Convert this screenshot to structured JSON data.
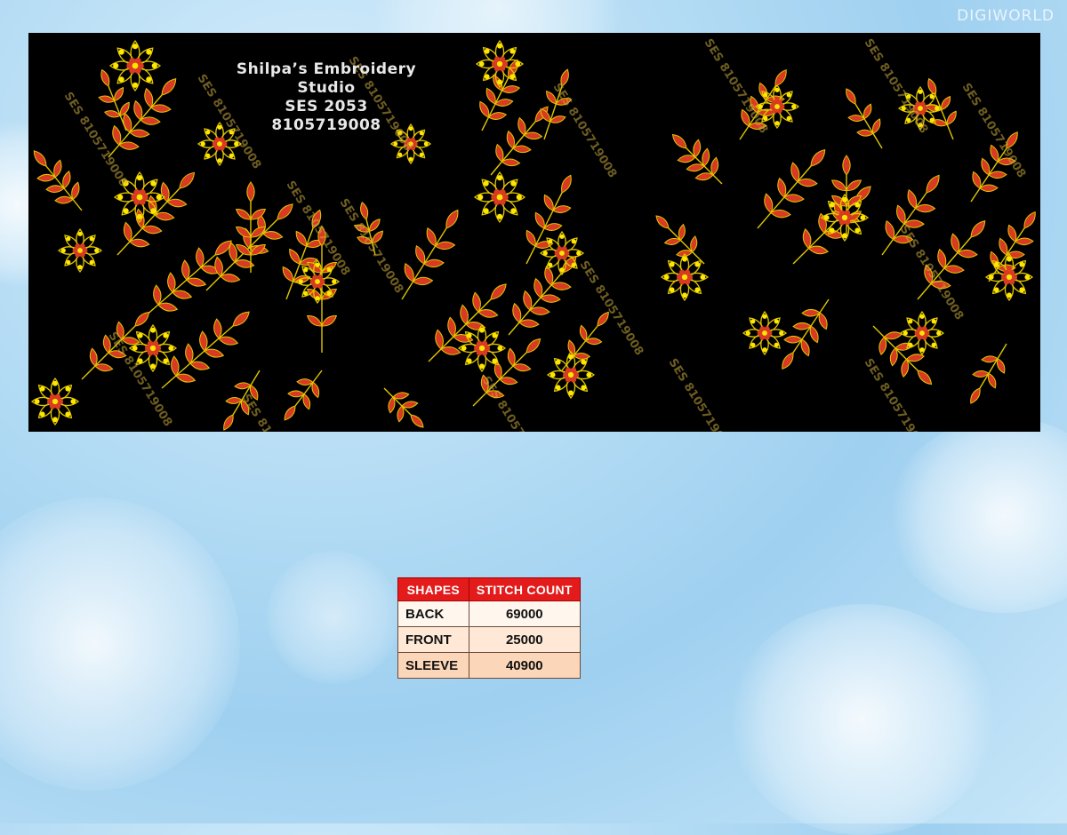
{
  "watermark_logo": "DIGIWORLD",
  "studio": {
    "name": "Shilpa’s Embroidery Studio",
    "design_code": "SES  2053",
    "phone": "8105719008"
  },
  "design_watermark": "SES 8105719008",
  "table": {
    "headers": [
      "SHAPES",
      "STITCH COUNT"
    ],
    "rows": [
      {
        "shape": "BACK",
        "count": "69000"
      },
      {
        "shape": "FRONT",
        "count": "25000"
      },
      {
        "shape": "SLEEVE",
        "count": "40900"
      }
    ]
  },
  "colors": {
    "panel": "#000000",
    "leaf": "#d93a22",
    "outline": "#e0c600",
    "dot": "#ffe600",
    "header": "#e31b1b"
  }
}
